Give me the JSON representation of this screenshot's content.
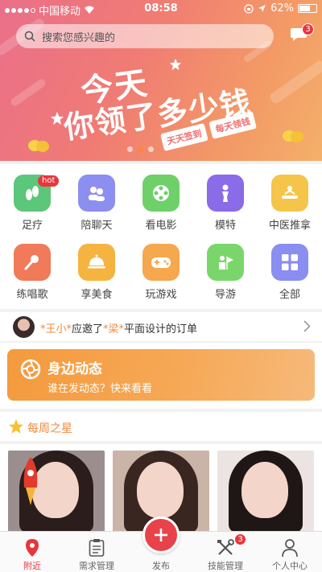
{
  "status_bar": {
    "carrier": "中国移动",
    "time": "08:58",
    "battery": "62%"
  },
  "search": {
    "placeholder": "搜索您感兴趣的"
  },
  "messages": {
    "badge": "3"
  },
  "banner": {
    "line1": "今天",
    "line2": "你领了多少钱",
    "tag1": "天天签到",
    "tag2": "每天领钱",
    "active_slide": 2,
    "slide_count": 3
  },
  "categories": [
    {
      "label": "足疗",
      "icon": "footprint-icon",
      "color": "#5cc67a",
      "badge": "hot"
    },
    {
      "label": "陪聊天",
      "icon": "chat-people-icon",
      "color": "#8c8ef0"
    },
    {
      "label": "看电影",
      "icon": "film-reel-icon",
      "color": "#6fd06a"
    },
    {
      "label": "模特",
      "icon": "model-figure-icon",
      "color": "#8a6be8"
    },
    {
      "label": "中医推拿",
      "icon": "massage-icon",
      "color": "#f5c54a"
    },
    {
      "label": "练唱歌",
      "icon": "microphone-icon",
      "color": "#f07a5a"
    },
    {
      "label": "享美食",
      "icon": "food-cloche-icon",
      "color": "#f5b340"
    },
    {
      "label": "玩游戏",
      "icon": "gamepad-icon",
      "color": "#f5a84e"
    },
    {
      "label": "导游",
      "icon": "tour-guide-icon",
      "color": "#7ad66a"
    },
    {
      "label": "全部",
      "icon": "grid-icon",
      "color": "#8a8ef0"
    }
  ],
  "ticker": {
    "user1": "*王小*",
    "middle": "应邀了",
    "user2": "*梁*",
    "tail": "平面设计的订单"
  },
  "moments": {
    "title": "身边动态",
    "subtitle": "谁在发动态？快来看看"
  },
  "weekly_star": {
    "title": "每周之星"
  },
  "tabs": [
    {
      "label": "附近",
      "icon": "location-pin-icon",
      "active": true
    },
    {
      "label": "需求管理",
      "icon": "clipboard-icon"
    },
    {
      "label": "发布",
      "icon": "plus-icon"
    },
    {
      "label": "技能管理",
      "icon": "tools-icon",
      "badge": "3"
    },
    {
      "label": "个人中心",
      "icon": "person-icon"
    }
  ],
  "colors": {
    "accent": "#e8363c",
    "orange": "#f08a3c"
  }
}
